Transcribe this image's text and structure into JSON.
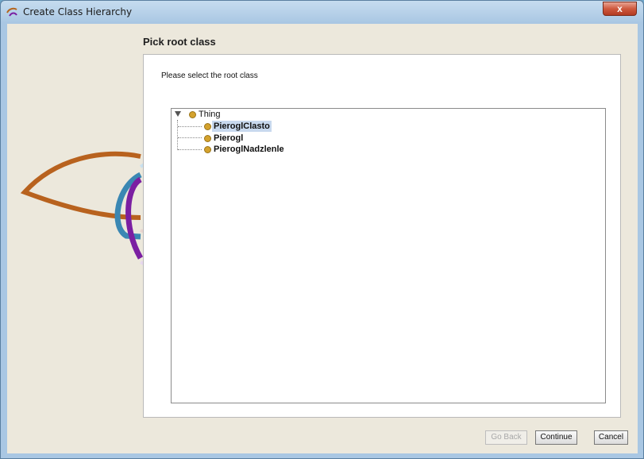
{
  "window": {
    "title": "Create Class Hierarchy",
    "close_label": "x"
  },
  "wizard": {
    "heading": "Pick root class",
    "instruction": "Please select the root class"
  },
  "tree": {
    "root": {
      "label": "Thing",
      "expanded": true
    },
    "children": [
      {
        "label": "PieroglClasto",
        "selected": true
      },
      {
        "label": "Pierogl",
        "selected": false
      },
      {
        "label": "PieroglNadzlenle",
        "selected": false
      }
    ]
  },
  "buttons": {
    "back": "Go Back",
    "continue": "Continue",
    "cancel": "Cancel"
  },
  "colors": {
    "class_bullet": "#d4a22d",
    "selection": "#c8d9ee",
    "close_button": "#cf5a3f"
  }
}
